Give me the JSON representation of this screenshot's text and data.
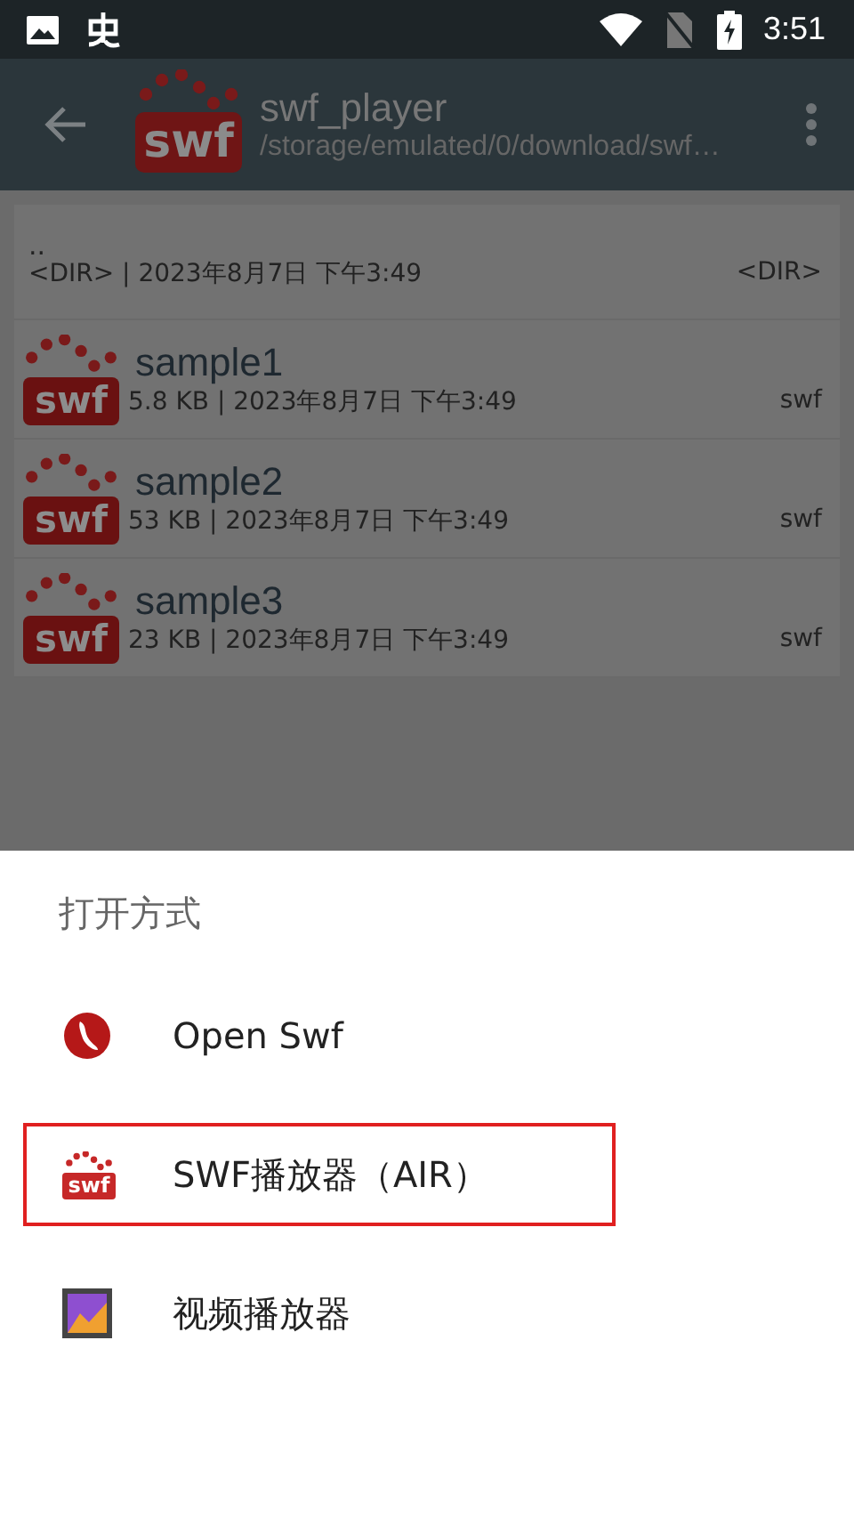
{
  "status_bar": {
    "time": "3:51"
  },
  "toolbar": {
    "logo_text": "swf",
    "title": "swf_player",
    "path": "/storage/emulated/0/download/swf…"
  },
  "files": [
    {
      "kind": "dir",
      "name": "..",
      "details": "<DIR> | 2023年8月7日 下午3:49",
      "type": "<DIR>"
    },
    {
      "kind": "file",
      "icon_text": "swf",
      "name": "sample1",
      "details": "5.8 KB | 2023年8月7日 下午3:49",
      "type": "swf"
    },
    {
      "kind": "file",
      "icon_text": "swf",
      "name": "sample2",
      "details": "53 KB | 2023年8月7日 下午3:49",
      "type": "swf"
    },
    {
      "kind": "file",
      "icon_text": "swf",
      "name": "sample3",
      "details": "23 KB | 2023年8月7日 下午3:49",
      "type": "swf"
    }
  ],
  "dialog": {
    "title": "打开方式",
    "options": [
      {
        "kind": "openswf",
        "label": "Open Swf",
        "selected": false
      },
      {
        "kind": "swf",
        "icon_text": "swf",
        "label": "SWF播放器（AIR）",
        "selected": true
      },
      {
        "kind": "video",
        "label": "视频播放器",
        "selected": false
      }
    ]
  }
}
